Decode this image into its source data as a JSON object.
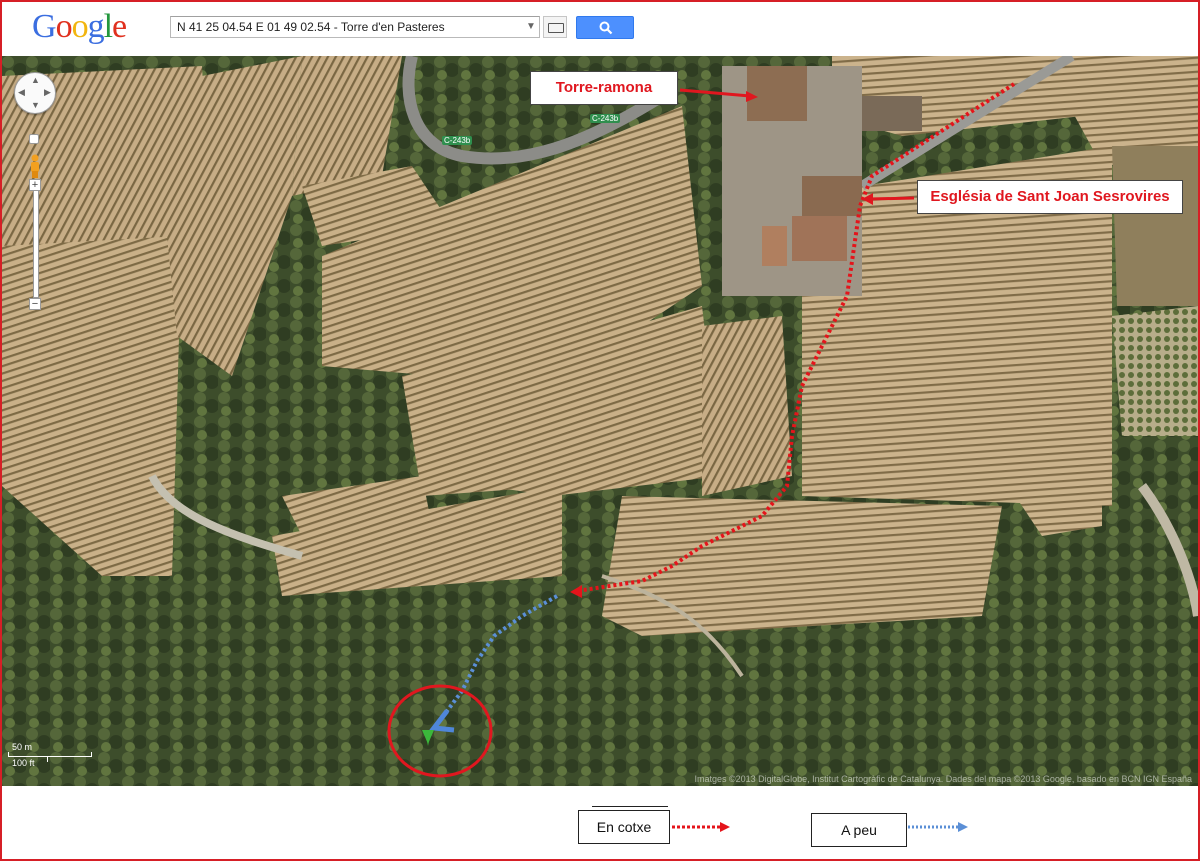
{
  "header": {
    "logo_text": "Google",
    "search_value": "N 41 25 04.54 E 01 49 02.54 - Torre d'en Pasteres",
    "search_button_icon": "search-icon",
    "keyboard_icon": "keyboard-icon"
  },
  "map": {
    "labels": {
      "torre": "Torre-ramona",
      "esglesia": "Església de Sant Joan Sesrovires"
    },
    "road_labels": [
      "C-243b",
      "C-243b"
    ],
    "scale": {
      "metric": "50 m",
      "imperial": "100 ft"
    },
    "attribution": "Imatges ©2013 DigitalGlobe, Institut Cartogràfic de Catalunya. Dades del mapa ©2013 Google, basado en BCN IGN España"
  },
  "legend": {
    "car_label": "En cotxe",
    "foot_label": "A peu",
    "colors": {
      "car": "#e4141b",
      "foot": "#5b8fd6",
      "circle": "#e0171f"
    }
  }
}
